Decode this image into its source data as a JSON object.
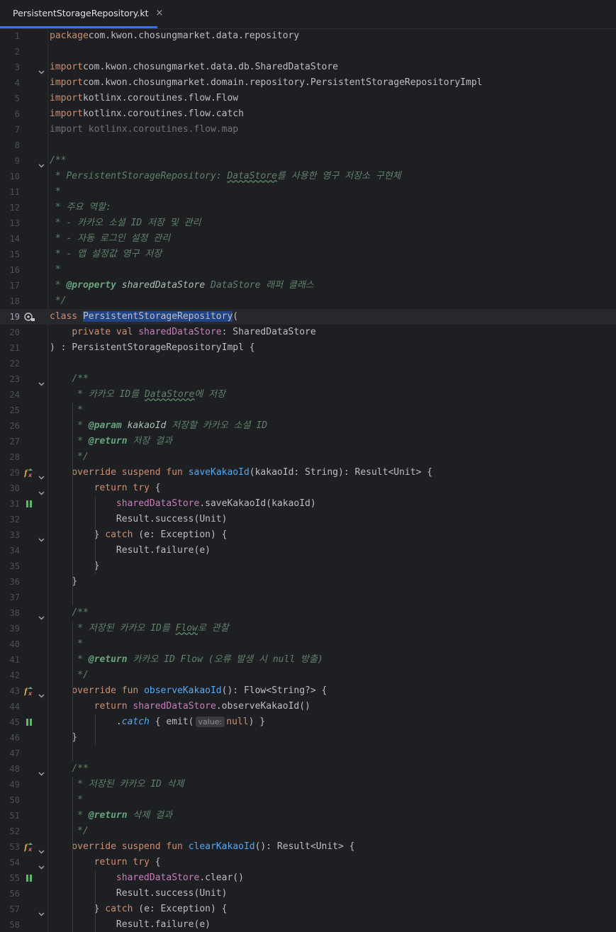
{
  "tab": {
    "title": "PersistentStorageRepository.kt",
    "close": "×"
  },
  "lines": [
    {
      "n": "1",
      "segs": [
        [
          "kw",
          "package"
        ],
        [
          "",
          "com.kwon.chosungmarket.data.repository"
        ]
      ]
    },
    {
      "n": "2",
      "segs": []
    },
    {
      "n": "3",
      "fold": true,
      "segs": [
        [
          "kw",
          "import"
        ],
        [
          "",
          "com.kwon.chosungmarket.data.db.SharedDataStore"
        ]
      ]
    },
    {
      "n": "4",
      "segs": [
        [
          "kw",
          "import"
        ],
        [
          "",
          "com.kwon.chosungmarket.domain.repository.PersistentStorageRepositoryImpl"
        ]
      ]
    },
    {
      "n": "5",
      "segs": [
        [
          "kw",
          "import"
        ],
        [
          "",
          "kotlinx.coroutines.flow.Flow"
        ]
      ]
    },
    {
      "n": "6",
      "segs": [
        [
          "kw",
          "import"
        ],
        [
          "",
          "kotlinx.coroutines.flow.catch"
        ]
      ]
    },
    {
      "n": "7",
      "segs": [
        [
          "dim",
          "import kotlinx.coroutines.flow.map"
        ]
      ]
    },
    {
      "n": "8",
      "segs": []
    },
    {
      "n": "9",
      "fold": true,
      "segs": [
        [
          "cm",
          "/**"
        ]
      ]
    },
    {
      "n": "10",
      "segs": [
        [
          "cm",
          " * PersistentStorageRepository: "
        ],
        [
          "cm spell",
          "DataStore"
        ],
        [
          "cm",
          "를 사용한 영구 저장소 구현체"
        ]
      ]
    },
    {
      "n": "11",
      "segs": [
        [
          "cm",
          " *"
        ]
      ]
    },
    {
      "n": "12",
      "segs": [
        [
          "cm",
          " * 주요 역할:"
        ]
      ]
    },
    {
      "n": "13",
      "segs": [
        [
          "cm",
          " * - 카카오 소셜 ID 저장 및 관리"
        ]
      ]
    },
    {
      "n": "14",
      "segs": [
        [
          "cm",
          " * - 자동 로그인 설정 관리"
        ]
      ]
    },
    {
      "n": "15",
      "segs": [
        [
          "cm",
          " * - 앱 설정값 영구 저장"
        ]
      ]
    },
    {
      "n": "16",
      "segs": [
        [
          "cm",
          " *"
        ]
      ]
    },
    {
      "n": "17",
      "segs": [
        [
          "cm",
          " * "
        ],
        [
          "tag",
          "@property"
        ],
        [
          "tagv",
          " sharedDataStore"
        ],
        [
          "cm",
          " DataStore 래퍼 클래스"
        ]
      ]
    },
    {
      "n": "18",
      "segs": [
        [
          "cm",
          " */"
        ]
      ]
    },
    {
      "n": "19",
      "current": true,
      "icon": "bean",
      "segs": [
        [
          "kw",
          "class "
        ],
        [
          "hl",
          "PersistentStorageRepository"
        ],
        [
          "",
          "("
        ]
      ]
    },
    {
      "n": "20",
      "segs": [
        [
          "",
          "    "
        ],
        [
          "kw",
          "private val "
        ],
        [
          "prop",
          "sharedDataStore"
        ],
        [
          "",
          ": SharedDataStore"
        ]
      ]
    },
    {
      "n": "21",
      "segs": [
        [
          "",
          ") : PersistentStorageRepositoryImpl {"
        ]
      ]
    },
    {
      "n": "22",
      "segs": []
    },
    {
      "n": "23",
      "fold": true,
      "segs": [
        [
          "",
          "    "
        ],
        [
          "cm",
          "/**"
        ]
      ]
    },
    {
      "n": "24",
      "segs": [
        [
          "cm",
          "     * 카카오 ID를 "
        ],
        [
          "cm spell",
          "DataStore"
        ],
        [
          "cm",
          "에 저장"
        ]
      ]
    },
    {
      "n": "25",
      "segs": [
        [
          "cm",
          "     *"
        ]
      ]
    },
    {
      "n": "26",
      "segs": [
        [
          "cm",
          "     * "
        ],
        [
          "tag",
          "@param"
        ],
        [
          "tagv",
          " kakaoId"
        ],
        [
          "cm",
          " 저장할 카카오 소셜 ID"
        ]
      ]
    },
    {
      "n": "27",
      "segs": [
        [
          "cm",
          "     * "
        ],
        [
          "tag",
          "@return"
        ],
        [
          "cm",
          " 저장 결과"
        ]
      ]
    },
    {
      "n": "28",
      "segs": [
        [
          "cm",
          "     */"
        ]
      ]
    },
    {
      "n": "29",
      "fold": true,
      "icon": "fx",
      "segs": [
        [
          "",
          "    "
        ],
        [
          "kw",
          "override suspend fun "
        ],
        [
          "fn",
          "saveKakaoId"
        ],
        [
          "",
          "(kakaoId: String): Result<Unit> {"
        ]
      ]
    },
    {
      "n": "30",
      "fold": true,
      "segs": [
        [
          "",
          "        "
        ],
        [
          "kw",
          "return try"
        ],
        [
          "",
          " {"
        ]
      ]
    },
    {
      "n": "31",
      "icon": "pause",
      "segs": [
        [
          "",
          "            "
        ],
        [
          "prop",
          "sharedDataStore"
        ],
        [
          "",
          ".saveKakaoId(kakaoId)"
        ]
      ]
    },
    {
      "n": "32",
      "segs": [
        [
          "",
          "            Result.success(Unit)"
        ]
      ]
    },
    {
      "n": "33",
      "fold": true,
      "segs": [
        [
          "",
          "        } "
        ],
        [
          "kw",
          "catch"
        ],
        [
          "",
          " (e: Exception) {"
        ]
      ]
    },
    {
      "n": "34",
      "segs": [
        [
          "",
          "            Result.failure(e)"
        ]
      ]
    },
    {
      "n": "35",
      "segs": [
        [
          "",
          "        }"
        ]
      ]
    },
    {
      "n": "36",
      "segs": [
        [
          "",
          "    }"
        ]
      ]
    },
    {
      "n": "37",
      "segs": []
    },
    {
      "n": "38",
      "fold": true,
      "segs": [
        [
          "",
          "    "
        ],
        [
          "cm",
          "/**"
        ]
      ]
    },
    {
      "n": "39",
      "segs": [
        [
          "cm",
          "     * 저장된 카카오 ID를 "
        ],
        [
          "cm spell",
          "Flow"
        ],
        [
          "cm",
          "로 관찰"
        ]
      ]
    },
    {
      "n": "40",
      "segs": [
        [
          "cm",
          "     *"
        ]
      ]
    },
    {
      "n": "41",
      "segs": [
        [
          "cm",
          "     * "
        ],
        [
          "tag",
          "@return"
        ],
        [
          "cm",
          " 카카오 ID Flow (오류 발생 시 null 방출)"
        ]
      ]
    },
    {
      "n": "42",
      "segs": [
        [
          "cm",
          "     */"
        ]
      ]
    },
    {
      "n": "43",
      "fold": true,
      "icon": "fx",
      "segs": [
        [
          "",
          "    "
        ],
        [
          "kw",
          "override fun "
        ],
        [
          "fn",
          "observeKakaoId"
        ],
        [
          "",
          "(): Flow<String?> {"
        ]
      ]
    },
    {
      "n": "44",
      "segs": [
        [
          "",
          "        "
        ],
        [
          "kw",
          "return "
        ],
        [
          "prop",
          "sharedDataStore"
        ],
        [
          "",
          ".observeKakaoId()"
        ]
      ]
    },
    {
      "n": "45",
      "icon": "pause",
      "segs": [
        [
          "",
          "            ."
        ],
        [
          "ext",
          "catch"
        ],
        [
          "",
          " { emit("
        ],
        [
          "hint",
          "value:"
        ],
        [
          "kw",
          "null"
        ],
        [
          "",
          ") }"
        ]
      ]
    },
    {
      "n": "46",
      "segs": [
        [
          "",
          "    }"
        ]
      ]
    },
    {
      "n": "47",
      "segs": []
    },
    {
      "n": "48",
      "fold": true,
      "segs": [
        [
          "",
          "    "
        ],
        [
          "cm",
          "/**"
        ]
      ]
    },
    {
      "n": "49",
      "segs": [
        [
          "cm",
          "     * 저장된 카카오 ID 삭제"
        ]
      ]
    },
    {
      "n": "50",
      "segs": [
        [
          "cm",
          "     *"
        ]
      ]
    },
    {
      "n": "51",
      "segs": [
        [
          "cm",
          "     * "
        ],
        [
          "tag",
          "@return"
        ],
        [
          "cm",
          " 삭제 결과"
        ]
      ]
    },
    {
      "n": "52",
      "segs": [
        [
          "cm",
          "     */"
        ]
      ]
    },
    {
      "n": "53",
      "fold": true,
      "icon": "fx",
      "segs": [
        [
          "",
          "    "
        ],
        [
          "kw",
          "override suspend fun "
        ],
        [
          "fn",
          "clearKakaoId"
        ],
        [
          "",
          "(): Result<Unit> {"
        ]
      ]
    },
    {
      "n": "54",
      "fold": true,
      "segs": [
        [
          "",
          "        "
        ],
        [
          "kw",
          "return try"
        ],
        [
          "",
          " {"
        ]
      ]
    },
    {
      "n": "55",
      "icon": "pause",
      "segs": [
        [
          "",
          "            "
        ],
        [
          "prop",
          "sharedDataStore"
        ],
        [
          "",
          ".clear()"
        ]
      ]
    },
    {
      "n": "56",
      "segs": [
        [
          "",
          "            Result.success(Unit)"
        ]
      ]
    },
    {
      "n": "57",
      "fold": true,
      "segs": [
        [
          "",
          "        } "
        ],
        [
          "kw",
          "catch"
        ],
        [
          "",
          " (e: Exception) {"
        ]
      ]
    },
    {
      "n": "58",
      "segs": [
        [
          "",
          "            Result.failure(e)"
        ]
      ]
    }
  ]
}
